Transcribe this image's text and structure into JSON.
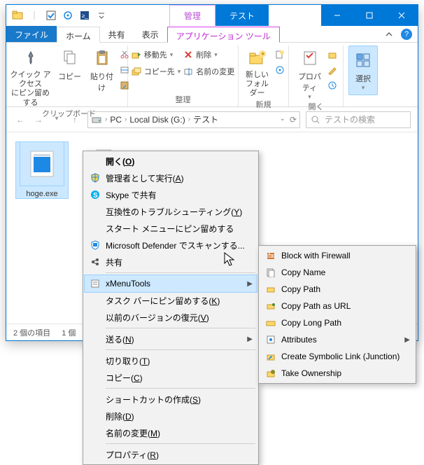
{
  "titlebar": {
    "tab_manage": "管理",
    "tab_test": "テスト"
  },
  "ribbon_tabs": {
    "file": "ファイル",
    "home": "ホーム",
    "share": "共有",
    "view": "表示",
    "apptools": "アプリケーション ツール"
  },
  "ribbon": {
    "quick_access_pin": "クイック アクセス\nにピン留めする",
    "copy": "コピー",
    "paste": "貼り付け",
    "clipboard_label": "クリップボード",
    "move_to": "移動先",
    "copy_to": "コピー先",
    "delete": "削除",
    "rename": "名前の変更",
    "organize_label": "整理",
    "new_folder": "新しい\nフォルダー",
    "new_label": "新規",
    "properties": "プロパティ",
    "open_label": "開く",
    "select": "選択",
    "select_label": ""
  },
  "breadcrumb": {
    "pc": "PC",
    "disk": "Local Disk (G:)",
    "folder": "テスト"
  },
  "search": {
    "placeholder": "テストの検索"
  },
  "files": {
    "item1": "hoge.exe"
  },
  "status": {
    "count": "2 個の項目",
    "selected": "1 個"
  },
  "ctx": {
    "open": "開く(O)",
    "run_admin": "管理者として実行(A)",
    "skype": "Skype で共有",
    "compat": "互換性のトラブルシューティング(Y)",
    "pin_start": "スタート メニューにピン留めする",
    "defender": "Microsoft Defender でスキャンする...",
    "share": "共有",
    "xmenu": "xMenuTools",
    "pin_task": "タスク バーにピン留めする(K)",
    "prev_ver": "以前のバージョンの復元(V)",
    "send_to": "送る(N)",
    "cut": "切り取り(T)",
    "copy": "コピー(C)",
    "shortcut": "ショートカットの作成(S)",
    "delete": "削除(D)",
    "rename": "名前の変更(M)",
    "properties": "プロパティ(R)"
  },
  "sub": {
    "block_fw": "Block with Firewall",
    "copy_name": "Copy Name",
    "copy_path": "Copy Path",
    "copy_url": "Copy Path as URL",
    "copy_long": "Copy Long Path",
    "attrs": "Attributes",
    "symlink": "Create Symbolic Link (Junction)",
    "take_own": "Take Ownership"
  }
}
